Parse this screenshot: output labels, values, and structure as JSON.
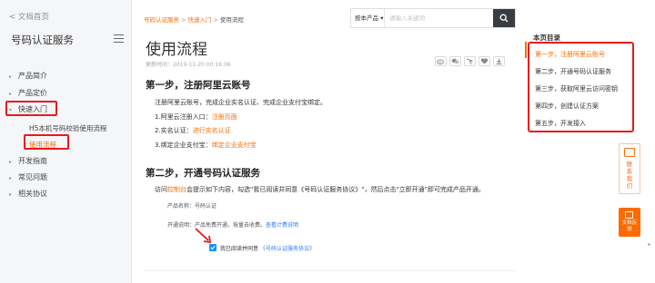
{
  "sidebar": {
    "back_label": "< 文档首页",
    "title": "号码认证服务",
    "items": [
      {
        "label": "产品简介"
      },
      {
        "label": "产品定价"
      },
      {
        "label": "快速入门"
      },
      {
        "label": "开发指南"
      },
      {
        "label": "常见问题"
      },
      {
        "label": "相关协议"
      }
    ],
    "sub_items": [
      {
        "label": "H5本机号码校验使用流程"
      },
      {
        "label": "使用流程"
      }
    ]
  },
  "breadcrumb": {
    "items": [
      "号码认证服务",
      "快速入门",
      "使用流程"
    ]
  },
  "search": {
    "select_label": "按本产品 ▾",
    "placeholder": "请输入关键词"
  },
  "page": {
    "title": "使用流程",
    "update_time": "更新时间：2019-11-20 00:16:06"
  },
  "step1": {
    "heading": "第一步，注册阿里云账号",
    "intro": "注册阿里云账号，完成企业实名认证、完成企业支付宝绑定。",
    "line1_prefix": "1.阿里云注册入口：",
    "line1_link": "注册页面",
    "line2_prefix": "2.实名认证：",
    "line2_link": "进行实名认证",
    "line3_prefix": "3.绑定企业支付宝：",
    "line3_link": "绑定企业支付宝"
  },
  "step2": {
    "heading": "第二步，开通号码认证服务",
    "text_prefix": "访问",
    "text_link": "控制台",
    "text_suffix": "会提示如下内容，勾选\"我已阅读并同意《号码认证服务协议》\"，然后点击\"立即开通\"即可完成产品开通。",
    "product_name": "产品名称：号码认证",
    "billing_prefix": "开通说明：产品免费开通，按量去收费。",
    "billing_link": "查看计费说明",
    "agree_text": "我已阅读并同意",
    "agree_link": "《号码认证服务协议》"
  },
  "toc": {
    "title": "本页目录",
    "items": [
      {
        "label": "第一步，注册阿里云账号"
      },
      {
        "label": "第二步，开通号码认证服务"
      },
      {
        "label": "第三步，获取阿里云访问密钥"
      },
      {
        "label": "第四步，创建认证方案"
      },
      {
        "label": "第五步，开发接入"
      }
    ]
  },
  "floating": {
    "contact_label": "联系我们",
    "feedback_label": "文档反馈"
  },
  "colors": {
    "accent": "#ff6a00",
    "highlight": "#e8191c",
    "link": "#2f7bf5"
  }
}
